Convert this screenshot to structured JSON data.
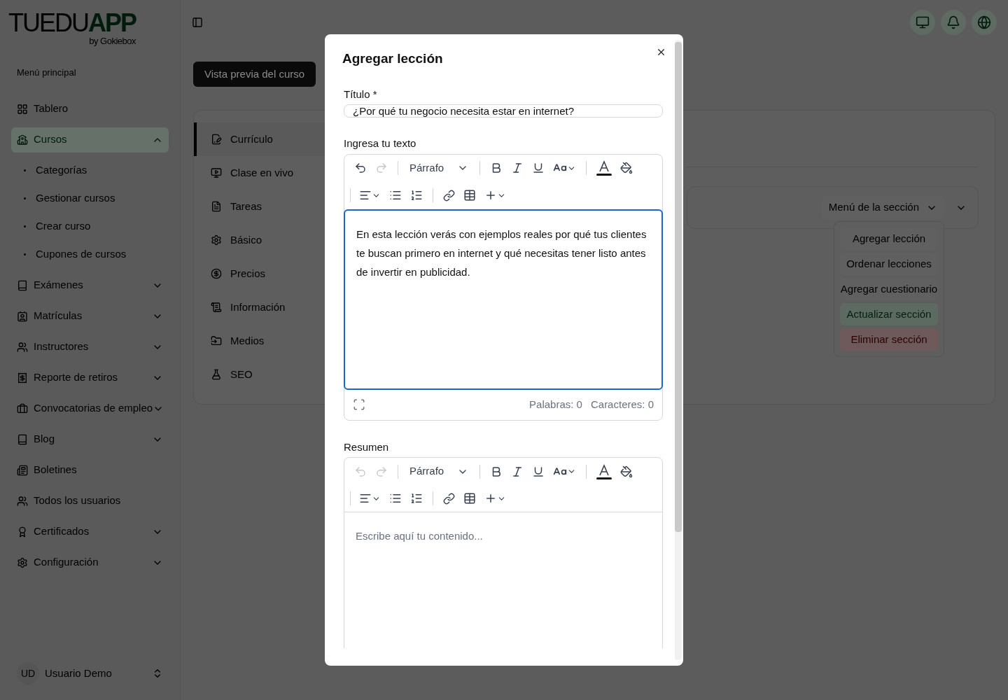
{
  "logo": {
    "name_light": "TUEDU",
    "name_bold": "APP",
    "tagline": "by Gokiebox"
  },
  "sidebar": {
    "section_title": "Menú principal",
    "items": [
      {
        "label": "Tablero",
        "selected": false
      },
      {
        "label": "Cursos",
        "expanded": true,
        "selected": true,
        "children": [
          {
            "label": "Categorías",
            "selected": false
          },
          {
            "label": "Gestionar cursos",
            "selected": false
          },
          {
            "label": "Crear curso",
            "selected": false
          },
          {
            "label": "Cupones de cursos",
            "selected": false
          }
        ]
      },
      {
        "label": "Exámenes",
        "expanded": false,
        "selected": false
      },
      {
        "label": "Matrículas",
        "expanded": false,
        "selected": false
      },
      {
        "label": "Instructores",
        "expanded": false,
        "selected": false
      },
      {
        "label": "Reporte de retiros",
        "expanded": false,
        "selected": false
      },
      {
        "label": "Convocatorias de empleo",
        "expanded": false,
        "selected": false
      },
      {
        "label": "Blog",
        "expanded": false,
        "selected": false
      },
      {
        "label": "Boletines",
        "selected": false
      },
      {
        "label": "Todos los usuarios",
        "selected": false
      },
      {
        "label": "Certificados",
        "expanded": false,
        "selected": false
      },
      {
        "label": "Configuración",
        "expanded": false,
        "selected": false
      }
    ],
    "user": {
      "initials": "UD",
      "name": "Usuario Demo"
    }
  },
  "preview_button": "Vista previa del curso",
  "course_tabs": [
    {
      "label": "Currículo",
      "selected": true
    },
    {
      "label": "Clase en vivo",
      "selected": false
    },
    {
      "label": "Tareas",
      "selected": false
    },
    {
      "label": "Básico",
      "selected": false
    },
    {
      "label": "Precios",
      "selected": false
    },
    {
      "label": "Información",
      "selected": false
    },
    {
      "label": "Medios",
      "selected": false
    },
    {
      "label": "SEO",
      "selected": false
    }
  ],
  "section": {
    "menu_button": "Menú de la sección",
    "menu": [
      {
        "label": "Agregar lección",
        "kind": "default"
      },
      {
        "label": "Ordenar lecciones",
        "kind": "default"
      },
      {
        "label": "Agregar cuestionario",
        "kind": "default"
      },
      {
        "label": "Actualizar sección",
        "kind": "success"
      },
      {
        "label": "Eliminar sección",
        "kind": "danger"
      }
    ]
  },
  "dialog": {
    "title": "Agregar lección",
    "title_field": {
      "label": "Título *",
      "value": "¿Por qué tu negocio necesita estar en internet?"
    },
    "editors": [
      {
        "label": "Ingresa tu texto",
        "block_style": "Párrafo",
        "undo_disabled": false,
        "redo_disabled": true,
        "focused": true,
        "content": "En esta lección verás con ejemplos reales por qué tus clientes te buscan primero en internet y qué necesitas tener listo antes de invertir en publicidad.",
        "words": "Palabras: 0",
        "characters": "Caracteres: 0"
      },
      {
        "label": "Resumen",
        "block_style": "Párrafo",
        "undo_disabled": true,
        "redo_disabled": true,
        "focused": false,
        "placeholder": "Escribe aquí tu contenido..."
      }
    ]
  }
}
